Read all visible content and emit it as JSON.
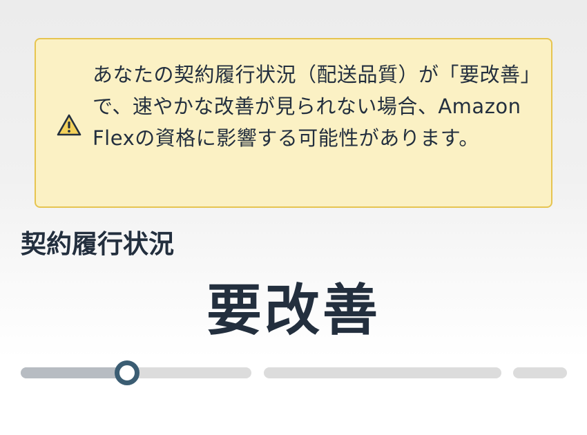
{
  "alert": {
    "icon": "warning-icon",
    "message": "あなたの契約履行状況（配送品質）が「要改善」で、速やかな改善が見られない場合、Amazon Flexの資格に影響する可能性があります。",
    "background_color": "#fbf1c4",
    "border_color": "#e6c44f"
  },
  "performance": {
    "title": "契約履行状況",
    "status": "要改善",
    "progress": {
      "segments": 3,
      "current_segment": 1,
      "position_in_segment": 0.46,
      "knob_color": "#3b5d73"
    }
  }
}
